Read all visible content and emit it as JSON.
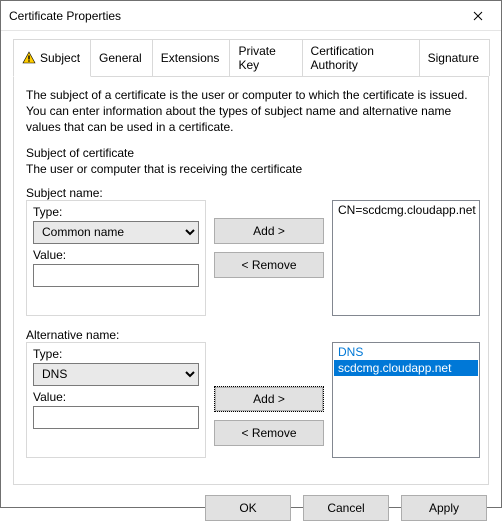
{
  "window": {
    "title": "Certificate Properties",
    "close_aria": "Close"
  },
  "tabs": {
    "subject": "Subject",
    "general": "General",
    "extensions": "Extensions",
    "private_key": "Private Key",
    "ca": "Certification Authority",
    "signature": "Signature"
  },
  "description": "The subject of a certificate is the user or computer to which the certificate is issued. You can enter information about the types of subject name and alternative name values that can be used in a certificate.",
  "section": {
    "heading": "Subject of certificate",
    "sub": "The user or computer that is receiving the certificate"
  },
  "subject_name": {
    "group_label": "Subject name:",
    "type_label": "Type:",
    "type_value": "Common name",
    "value_label": "Value:",
    "value_input": "",
    "add_label": "Add >",
    "remove_label": "< Remove",
    "list": [
      "CN=scdcmg.cloudapp.net"
    ]
  },
  "alt_name": {
    "group_label": "Alternative name:",
    "type_label": "Type:",
    "type_value": "DNS",
    "value_label": "Value:",
    "value_input": "",
    "add_label": "Add >",
    "remove_label": "< Remove",
    "list_header": "DNS",
    "list": [
      "scdcmg.cloudapp.net"
    ]
  },
  "footer": {
    "ok": "OK",
    "cancel": "Cancel",
    "apply": "Apply"
  }
}
